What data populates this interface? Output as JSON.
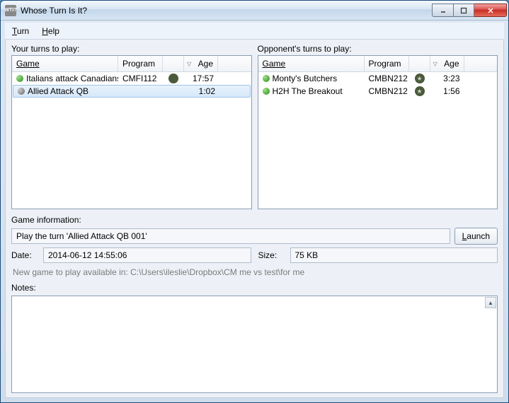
{
  "window": {
    "title": "Whose Turn Is It?",
    "icon_text": "WTI?"
  },
  "menu": {
    "turn": "Turn",
    "help": "Help"
  },
  "left_panel": {
    "label": "Your turns to play:",
    "headers": {
      "game": "Game",
      "program": "Program",
      "age": "Age"
    },
    "rows": [
      {
        "status": "green",
        "game": "Italians attack Canadians...",
        "program": "CMFI112",
        "icon": "plain",
        "age": "17:57",
        "selected": false
      },
      {
        "status": "grey",
        "game": "Allied Attack QB",
        "program": "",
        "icon": "",
        "age": "1:02",
        "selected": true
      }
    ]
  },
  "right_panel": {
    "label": "Opponent's turns to play:",
    "headers": {
      "game": "Game",
      "program": "Program",
      "age": "Age"
    },
    "rows": [
      {
        "status": "green",
        "game": "Monty's Butchers",
        "program": "CMBN212",
        "icon": "star",
        "age": "3:23",
        "selected": false
      },
      {
        "status": "green",
        "game": "H2H The Breakout",
        "program": "CMBN212",
        "icon": "star",
        "age": "1:56",
        "selected": false
      }
    ]
  },
  "info": {
    "label": "Game information:",
    "turn_text": "Play the turn 'Allied Attack QB 001'",
    "launch": "Launch",
    "date_label": "Date:",
    "date_value": "2014-06-12 14:55:06",
    "size_label": "Size:",
    "size_value": "75 KB",
    "status": "New game to play available in: C:\\Users\\ileslie\\Dropbox\\CM me vs test\\for me",
    "notes_label": "Notes:"
  }
}
